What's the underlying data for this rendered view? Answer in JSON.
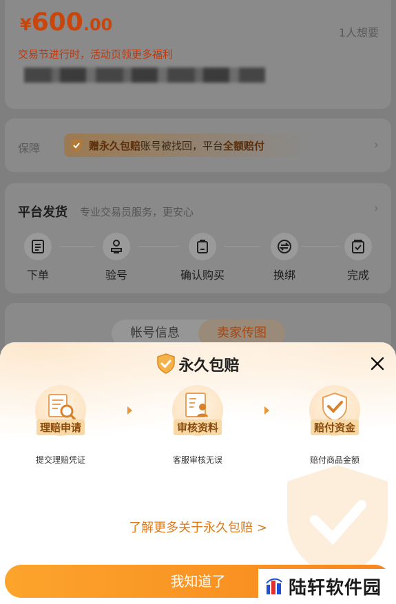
{
  "listing": {
    "price_currency": "¥",
    "price_int": "600",
    "price_dec": ".00",
    "wants": "1人想要",
    "promo": "交易节进行时，活动页领更多福利"
  },
  "guarantee": {
    "label": "保障",
    "badge": "赠永久包赔",
    "text_a": " 账号被找回，平台",
    "text_b": "全额赔付"
  },
  "shipping": {
    "title": "平台发货",
    "subtitle": "专业交易员服务，更安心",
    "steps": [
      {
        "label": "下单",
        "icon": "order-icon"
      },
      {
        "label": "验号",
        "icon": "verify-icon"
      },
      {
        "label": "确认购买",
        "icon": "confirm-purchase-icon"
      },
      {
        "label": "换绑",
        "icon": "rebind-icon"
      },
      {
        "label": "完成",
        "icon": "complete-icon"
      }
    ]
  },
  "tabs": [
    "帐号信息",
    "卖家传图"
  ],
  "sheet": {
    "title": "永久包赔",
    "process": [
      {
        "tag": "理赔申请",
        "desc": "提交理赔凭证"
      },
      {
        "tag": "审核资料",
        "desc": "客服审核无误"
      },
      {
        "tag": "赔付资金",
        "desc": "赔付商品金额"
      }
    ],
    "learn_more": "了解更多关于永久包赔 >",
    "ok": "我知道了"
  },
  "watermark": "陆轩软件园",
  "colors": {
    "accent": "#f7931e",
    "link": "#e07a1a",
    "price": "#c8450c"
  }
}
